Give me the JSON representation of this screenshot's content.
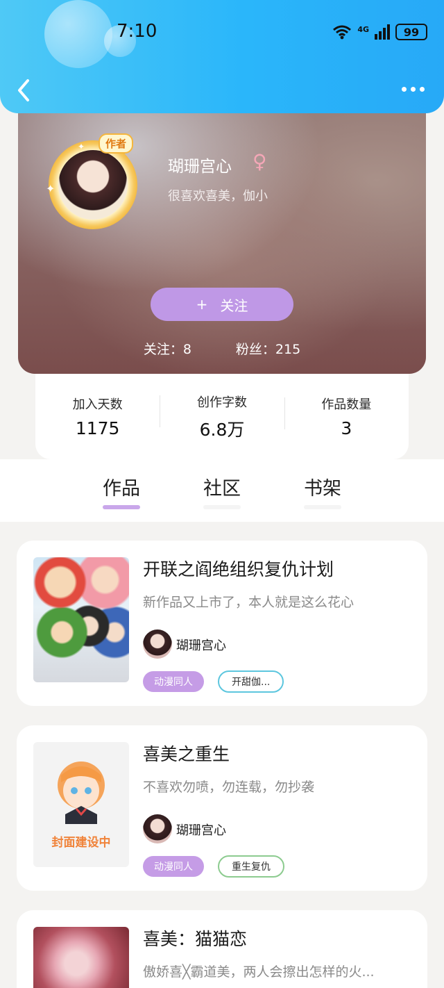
{
  "status_bar": {
    "time": "7:10",
    "network": "4G",
    "battery": "99"
  },
  "header": {
    "back_icon": "chevron-left-icon",
    "more_icon": "more-dots-icon"
  },
  "profile": {
    "author_badge": "作者",
    "name": "瑚珊宫心",
    "gender_symbol": "♀",
    "bio": "很喜欢喜美，伽小",
    "follow_icon": "+",
    "follow_label": "关注",
    "following_label": "关注：8",
    "fans_label": "粉丝：215"
  },
  "stats": [
    {
      "label": "加入天数",
      "value": "1175"
    },
    {
      "label": "创作字数",
      "value": "6.8万"
    },
    {
      "label": "作品数量",
      "value": "3"
    }
  ],
  "tabs": [
    {
      "label": "作品",
      "active": true
    },
    {
      "label": "社区",
      "active": false
    },
    {
      "label": "书架",
      "active": false
    }
  ],
  "works": [
    {
      "title": "开联之阎绝组织复仇计划",
      "desc": "新作品又上市了，本人就是这么花心",
      "author": "瑚珊宫心",
      "genre_tag": "动漫同人",
      "sub_tag": "开甜伽...",
      "sub_tag_color": "#5cc6de"
    },
    {
      "title": "喜美之重生",
      "desc": "不喜欢勿喷，勿连载，勿抄袭",
      "author": "瑚珊宫心",
      "genre_tag": "动漫同人",
      "sub_tag": "重生复仇",
      "sub_tag_color": "#8ccb8f",
      "cover_text": "封面建设中"
    },
    {
      "title": "喜美：猫猫恋",
      "desc": "傲娇喜╳霸道美，两人会擦出怎样的火..."
    }
  ],
  "colors": {
    "header": "#2ab6fa",
    "accent_purple": "#bf98e6"
  }
}
